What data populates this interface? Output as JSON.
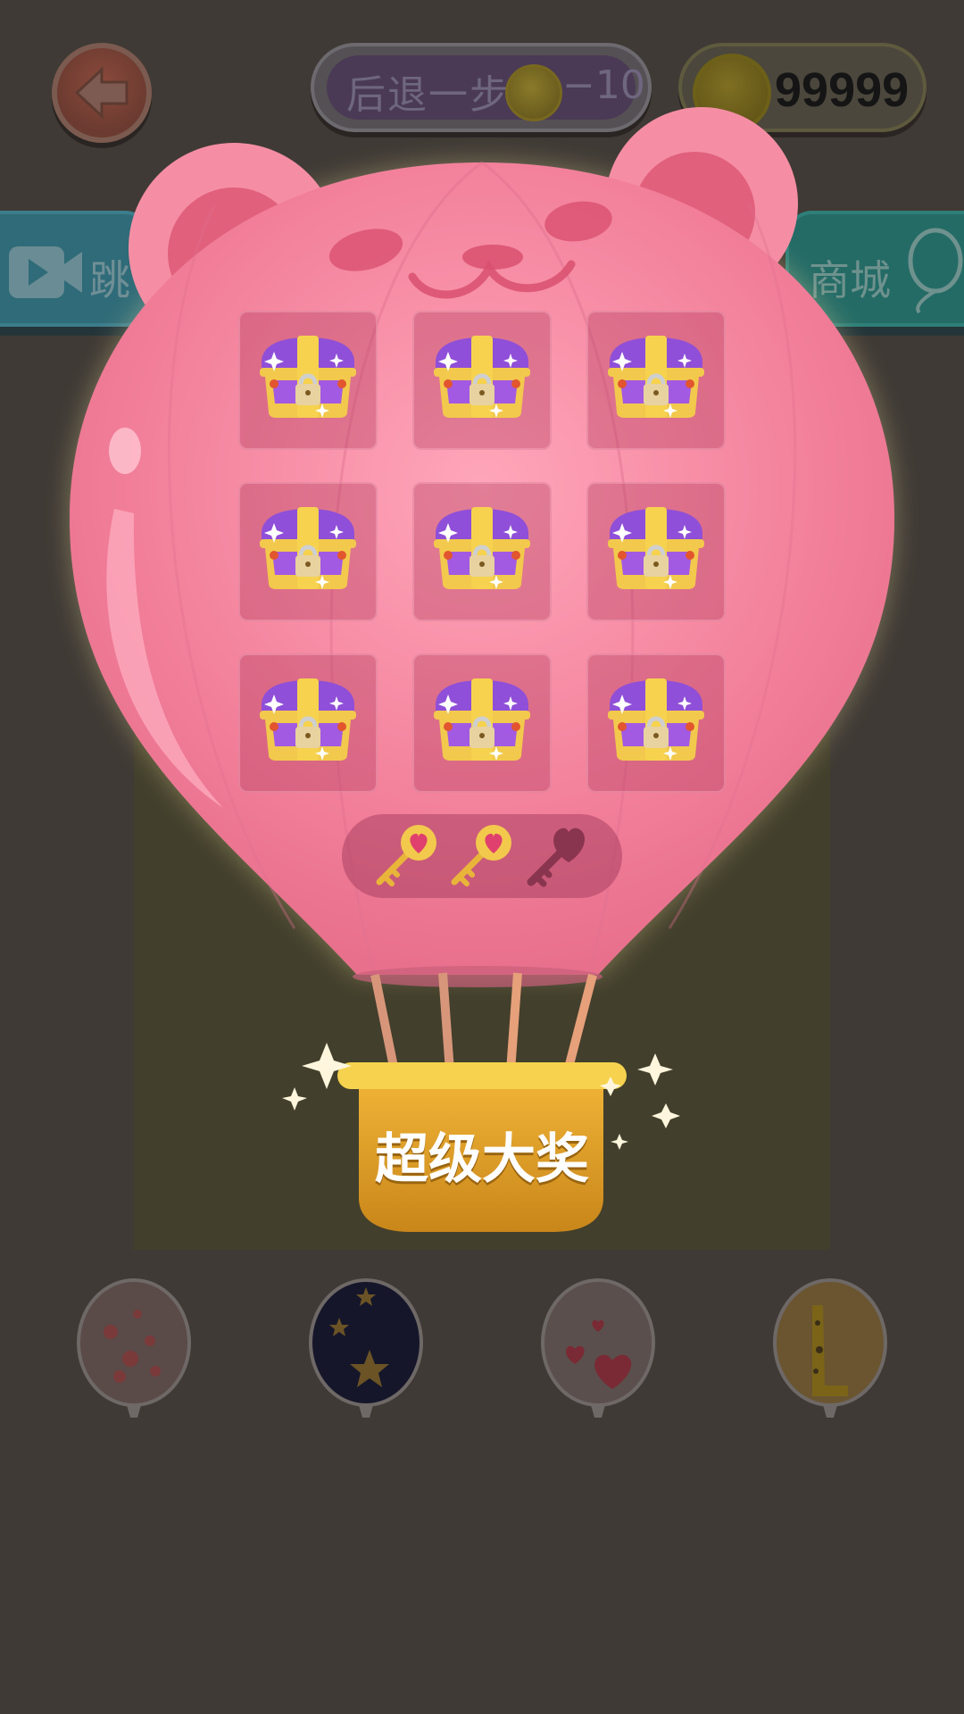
{
  "header": {
    "undo_label": "后退一步",
    "undo_cost": "−10",
    "coin_count": "99999"
  },
  "side_buttons": {
    "left_label": "跳",
    "right_label": "商城"
  },
  "prize": {
    "label": "超级大奖",
    "chests": [
      {
        "state": "locked"
      },
      {
        "state": "locked"
      },
      {
        "state": "locked"
      },
      {
        "state": "locked"
      },
      {
        "state": "locked"
      },
      {
        "state": "locked"
      },
      {
        "state": "locked"
      },
      {
        "state": "locked"
      },
      {
        "state": "locked"
      }
    ],
    "keys": {
      "collected": 2,
      "total": 3
    }
  },
  "skins": [
    {
      "name": "confetti-balloon-icon",
      "color": "#c23a3a"
    },
    {
      "name": "star-balloon-icon",
      "color": "#1c2240"
    },
    {
      "name": "heart-balloon-icon",
      "color": "#cc2233"
    },
    {
      "name": "giraffe-balloon-icon",
      "color": "#e6a020"
    }
  ],
  "colors": {
    "balloon_pink": "#f08aa0",
    "basket_gold": "#e1a22c",
    "background": "#3f3a35"
  }
}
